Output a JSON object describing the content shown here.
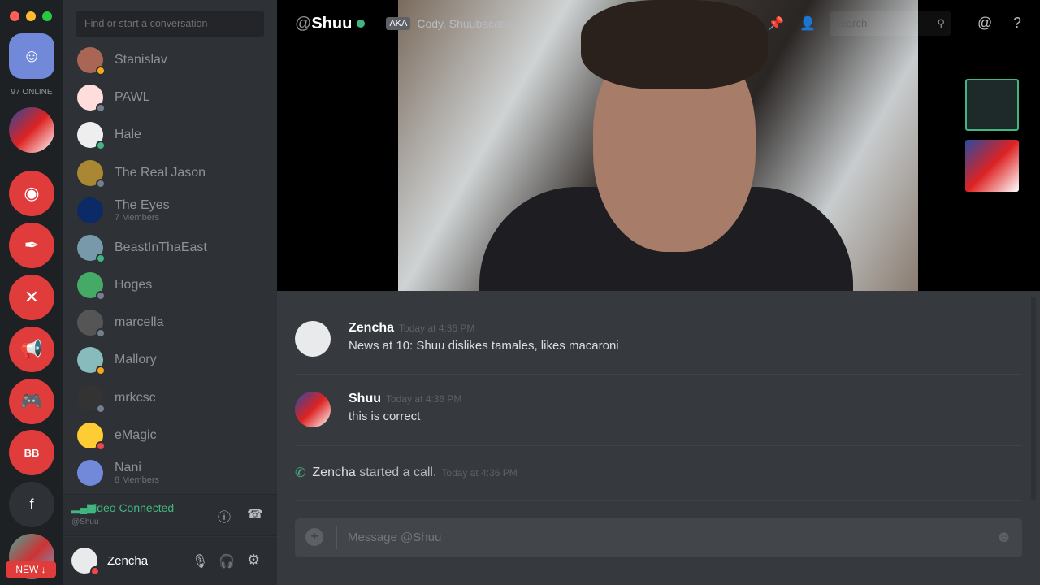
{
  "window": {
    "controls": [
      "close",
      "minimize",
      "maximize"
    ]
  },
  "guilds": {
    "online_label": "97 ONLINE",
    "items": [
      {
        "name": "friends",
        "icon": "friends-icon"
      },
      {
        "name": "user-server-1"
      },
      {
        "name": "discord",
        "icon": "discord-icon"
      },
      {
        "name": "pen-server",
        "icon": "pen-icon"
      },
      {
        "name": "tools-server",
        "icon": "tools-icon"
      },
      {
        "name": "megaphone-server",
        "icon": "megaphone-icon"
      },
      {
        "name": "gamepad-server",
        "icon": "gamepad-icon"
      },
      {
        "name": "bb-truck-server",
        "icon": "truck-icon",
        "label": "BB"
      },
      {
        "name": "f-server",
        "label": "f"
      },
      {
        "name": "captain-server"
      }
    ],
    "new_badge": "NEW ↓"
  },
  "dm": {
    "search_placeholder": "Find or start a conversation",
    "items": [
      {
        "name": "Stanislav",
        "status": "idle"
      },
      {
        "name": "PAWL",
        "status": "offline"
      },
      {
        "name": "Hale",
        "status": "online"
      },
      {
        "name": "The Real Jason",
        "status": "offline"
      },
      {
        "name": "The Eyes",
        "sub": "7 Members"
      },
      {
        "name": "BeastInThaEast",
        "status": "online"
      },
      {
        "name": "Hoges",
        "status": "offline"
      },
      {
        "name": "marcella",
        "status": "offline"
      },
      {
        "name": "Mallory",
        "status": "idle"
      },
      {
        "name": "mrkcsc",
        "status": "offline"
      },
      {
        "name": "eMagic",
        "status": "dnd"
      },
      {
        "name": "Nani",
        "sub": "8 Members"
      }
    ],
    "voice": {
      "status": "Video Connected",
      "channel": "@Shuu"
    },
    "user": {
      "name": "Zencha",
      "status": "dnd"
    }
  },
  "header": {
    "at": "@",
    "name": "Shuu",
    "aka_badge": "AKA",
    "aka": "Cody, Shuubacabra",
    "search_placeholder": "Search"
  },
  "messages": [
    {
      "author": "Zencha",
      "time": "Today at 4:36 PM",
      "text": "News at 10: Shuu dislikes tamales, likes macaroni"
    },
    {
      "author": "Shuu",
      "time": "Today at 4:36 PM",
      "text": "this is correct"
    }
  ],
  "system": {
    "author": "Zencha",
    "text": "started a call.",
    "time": "Today at 4:36 PM"
  },
  "composer": {
    "placeholder": "Message @Shuu"
  },
  "colors": {
    "online": "#43b581",
    "idle": "#faa61a",
    "dnd": "#f04747",
    "offline": "#747f8d",
    "brand": "#7289da"
  }
}
